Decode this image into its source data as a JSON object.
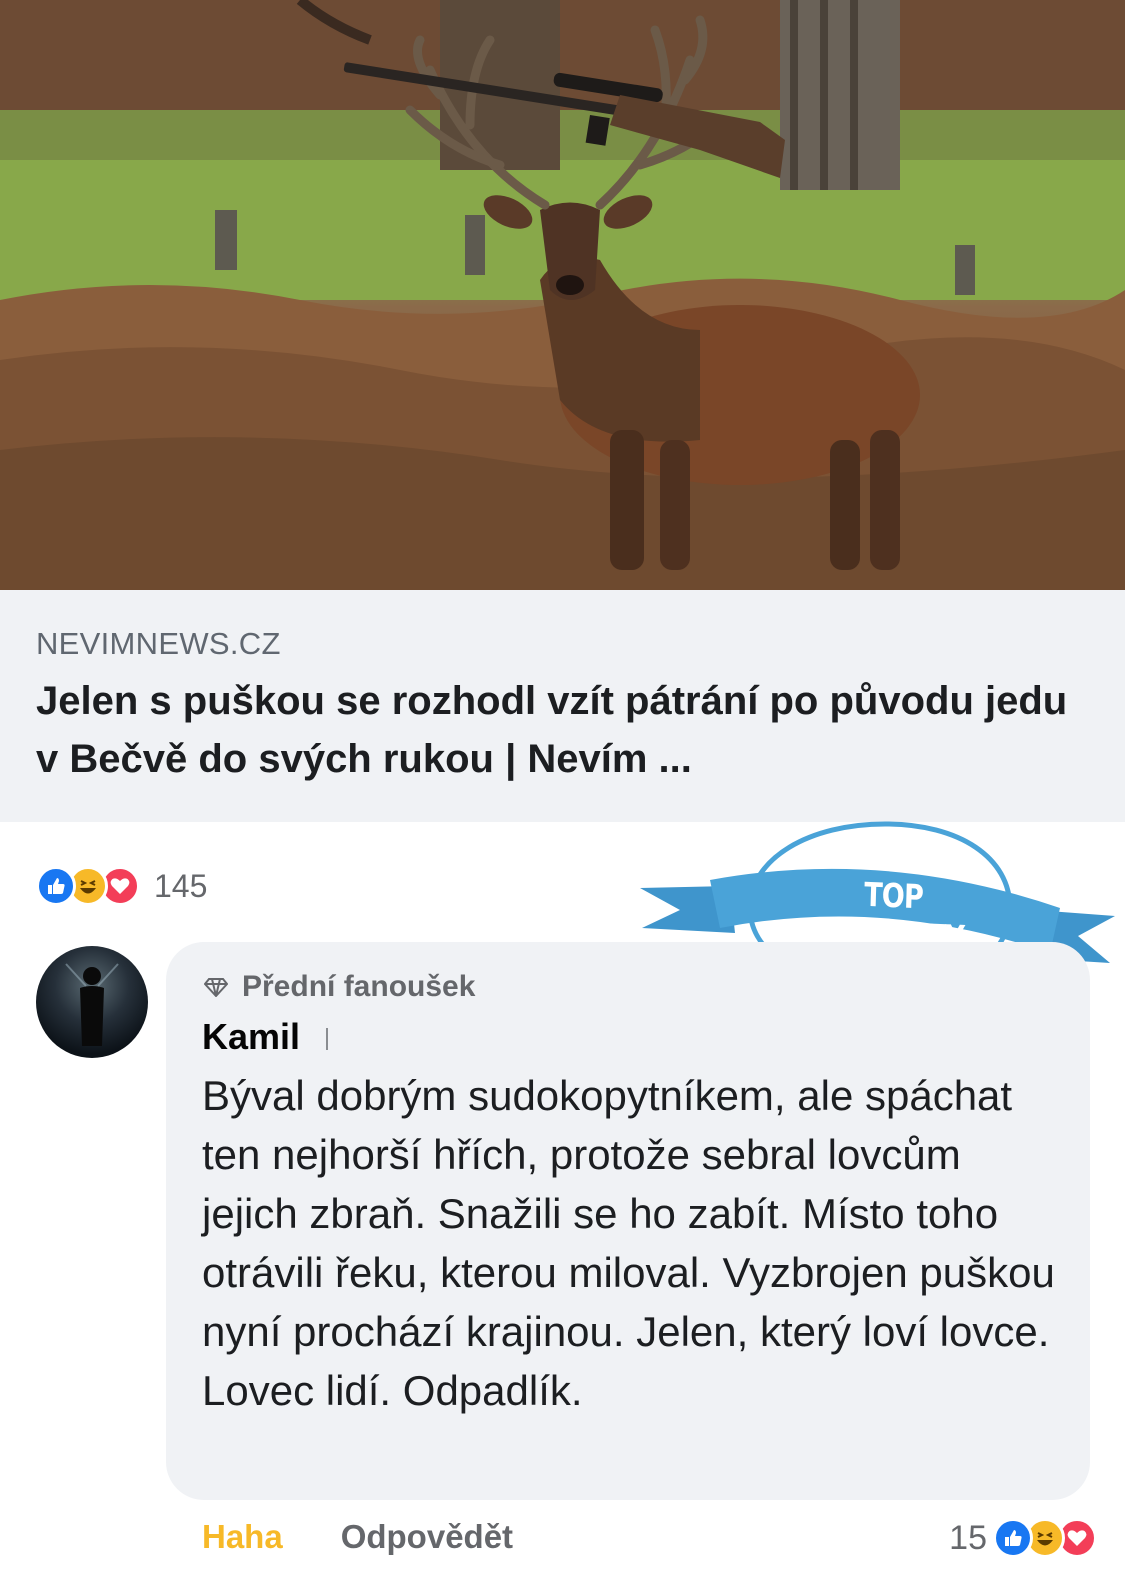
{
  "link_preview": {
    "domain": "NEVIMNEWS.CZ",
    "title": "Jelen s puškou se rozhodl vzít pátrání po původu jedu v Bečvě do svých rukou | Nevím ..."
  },
  "post_reactions": {
    "icons": [
      "like-icon",
      "haha-icon",
      "love-icon"
    ],
    "count": "145"
  },
  "top_comments_badge": {
    "label": "TOP KOMENTY",
    "color": "#4aa3d8"
  },
  "comment": {
    "badge": "Přední fanoušek",
    "author": "Kamil",
    "text": "Býval dobrým sudokopytníkem, ale spáchat ten nejhorší hřích, protože sebral lovcům jejich zbraň. Snažili se ho zabít. Místo toho otrávili řeku, kterou miloval. Vyzbrojen puškou nyní prochází krajinou. Jelen, který loví lovce. Lovec lidí. Odpadlík.",
    "actions": {
      "haha": "Haha",
      "reply": "Odpovědět"
    },
    "reaction_count": "15",
    "reaction_icons": [
      "like-icon",
      "haha-icon",
      "love-icon"
    ]
  },
  "colors": {
    "like": "#1877f2",
    "haha": "#f7b928",
    "love": "#f33e58",
    "bubble": "#f0f2f5"
  }
}
